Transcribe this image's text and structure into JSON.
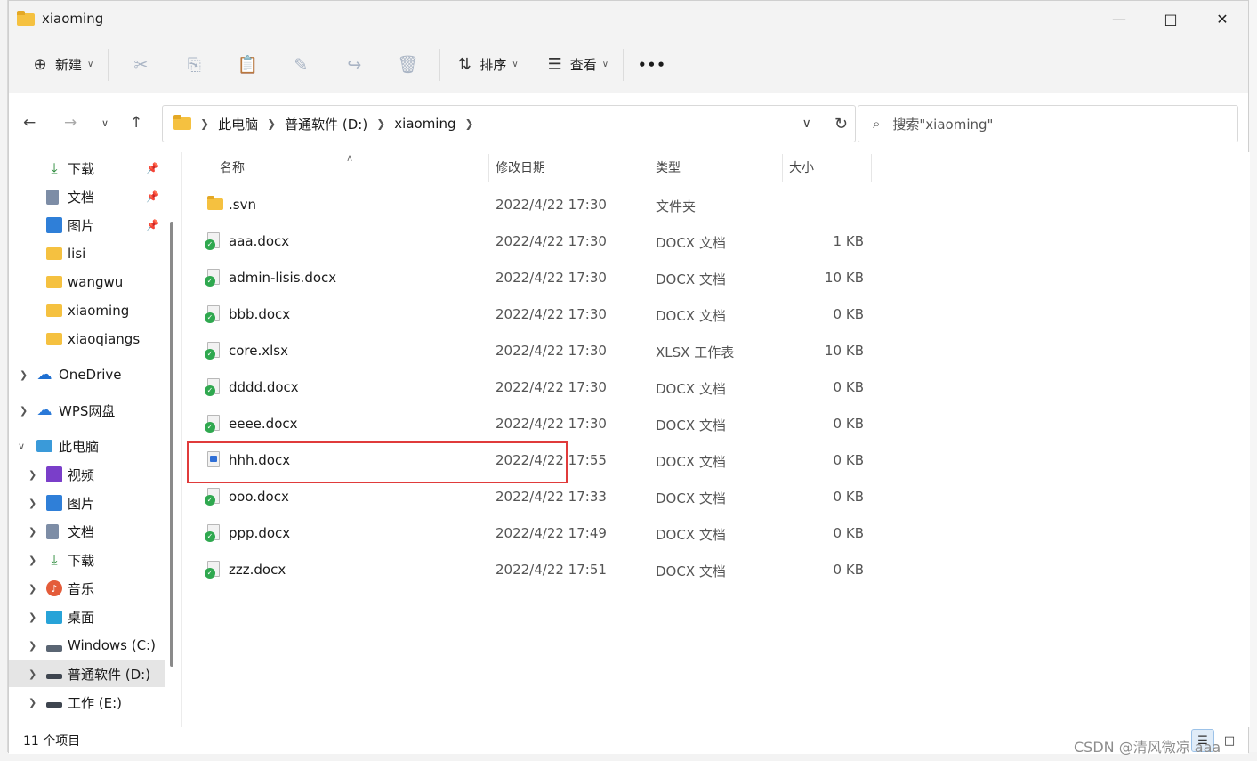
{
  "window": {
    "title": "xiaoming"
  },
  "toolbar": {
    "new_label": "新建",
    "sort_label": "排序",
    "view_label": "查看",
    "more_label": "•••"
  },
  "address": {
    "crumbs": [
      "此电脑",
      "普通软件 (D:)",
      "xiaoming"
    ]
  },
  "search": {
    "placeholder": "搜索\"xiaoming\""
  },
  "nav": {
    "items": [
      {
        "label": "下载",
        "icon": "download-icon",
        "pinned": true
      },
      {
        "label": "文档",
        "icon": "document-icon",
        "pinned": true
      },
      {
        "label": "图片",
        "icon": "picture-icon",
        "pinned": true
      },
      {
        "label": "lisi",
        "icon": "folder-icon"
      },
      {
        "label": "wangwu",
        "icon": "folder-icon"
      },
      {
        "label": "xiaoming",
        "icon": "folder-icon"
      },
      {
        "label": "xiaoqiangs",
        "icon": "folder-icon"
      },
      {
        "label": "OneDrive",
        "icon": "cloud-icon"
      },
      {
        "label": "WPS网盘",
        "icon": "cloud-icon"
      },
      {
        "label": "此电脑",
        "icon": "computer-icon"
      },
      {
        "label": "视频",
        "icon": "video-icon"
      },
      {
        "label": "图片",
        "icon": "picture-icon"
      },
      {
        "label": "文档",
        "icon": "document-icon"
      },
      {
        "label": "下载",
        "icon": "download-icon"
      },
      {
        "label": "音乐",
        "icon": "music-icon"
      },
      {
        "label": "桌面",
        "icon": "desktop-icon"
      },
      {
        "label": "Windows (C:)",
        "icon": "drive-icon"
      },
      {
        "label": "普通软件 (D:)",
        "icon": "drive-icon"
      },
      {
        "label": "工作 (E:)",
        "icon": "drive-icon"
      }
    ]
  },
  "columns": {
    "name": "名称",
    "date": "修改日期",
    "type": "类型",
    "size": "大小"
  },
  "files": [
    {
      "name": ".svn",
      "date": "2022/4/22 17:30",
      "type": "文件夹",
      "size": ""
    },
    {
      "name": "aaa.docx",
      "date": "2022/4/22 17:30",
      "type": "DOCX 文档",
      "size": "1 KB"
    },
    {
      "name": "admin-lisis.docx",
      "date": "2022/4/22 17:30",
      "type": "DOCX 文档",
      "size": "10 KB"
    },
    {
      "name": "bbb.docx",
      "date": "2022/4/22 17:30",
      "type": "DOCX 文档",
      "size": "0 KB"
    },
    {
      "name": "core.xlsx",
      "date": "2022/4/22 17:30",
      "type": "XLSX 工作表",
      "size": "10 KB"
    },
    {
      "name": "dddd.docx",
      "date": "2022/4/22 17:30",
      "type": "DOCX 文档",
      "size": "0 KB"
    },
    {
      "name": "eeee.docx",
      "date": "2022/4/22 17:30",
      "type": "DOCX 文档",
      "size": "0 KB"
    },
    {
      "name": "hhh.docx",
      "date": "2022/4/22 17:55",
      "type": "DOCX 文档",
      "size": "0 KB"
    },
    {
      "name": "ooo.docx",
      "date": "2022/4/22 17:33",
      "type": "DOCX 文档",
      "size": "0 KB"
    },
    {
      "name": "ppp.docx",
      "date": "2022/4/22 17:49",
      "type": "DOCX 文档",
      "size": "0 KB"
    },
    {
      "name": "zzz.docx",
      "date": "2022/4/22 17:51",
      "type": "DOCX 文档",
      "size": "0 KB"
    }
  ],
  "status": {
    "count": "11 个项目"
  },
  "watermark": "CSDN @清风微凉 aaa",
  "colors": {
    "highlight": "#e03b3b",
    "folder": "#f5c140",
    "svn_ok": "#2fa84f"
  }
}
